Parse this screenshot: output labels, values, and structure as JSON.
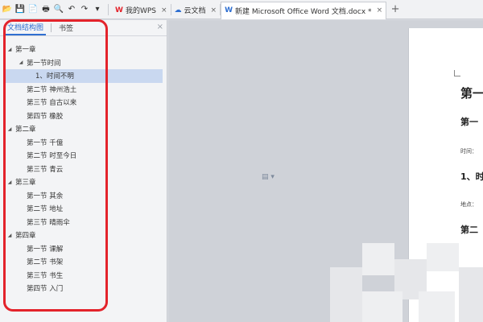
{
  "toolbar": {
    "quick_access": [
      {
        "icon": "folder-open-icon",
        "glyph": "📂"
      },
      {
        "icon": "save-icon",
        "glyph": "💾"
      },
      {
        "icon": "export-icon",
        "glyph": "📄"
      },
      {
        "icon": "print-icon",
        "glyph": "🖶"
      },
      {
        "icon": "print-preview-icon",
        "glyph": "🔍"
      },
      {
        "icon": "undo-icon",
        "glyph": "↶"
      },
      {
        "icon": "redo-icon",
        "glyph": "↷"
      },
      {
        "icon": "dropdown-icon",
        "glyph": "▾"
      }
    ],
    "tabs": [
      {
        "label": "我的WPS",
        "icon_glyph": "W",
        "icon_color": "#e3232b",
        "active": false
      },
      {
        "label": "云文档",
        "icon_glyph": "☁",
        "icon_color": "#2f6fd1",
        "active": false
      },
      {
        "label": "新建 Microsoft Office Word 文档.docx *",
        "icon_glyph": "W",
        "icon_color": "#2f6fd1",
        "active": true
      }
    ],
    "close_glyph": "×",
    "new_tab_glyph": "+"
  },
  "nav_panel": {
    "tabs": [
      "文档结构图",
      "书签"
    ],
    "close_glyph": "×",
    "outline": [
      {
        "label": "第一章",
        "level": 1,
        "expanded": true
      },
      {
        "label": "第一节时间",
        "level": 2,
        "expanded": true
      },
      {
        "label": "1、时间不明",
        "level": 3,
        "selected": true
      },
      {
        "label": "第二节 神州浩土",
        "level": "2-leaf"
      },
      {
        "label": "第三节 自古以来",
        "level": "2-leaf"
      },
      {
        "label": "第四节 橡胶",
        "level": "2-leaf"
      },
      {
        "label": "第二章",
        "level": 1,
        "expanded": true
      },
      {
        "label": "第一节 千億",
        "level": "2-leaf"
      },
      {
        "label": "第二节 时至今日",
        "level": "2-leaf"
      },
      {
        "label": "第三节 青云",
        "level": "2-leaf"
      },
      {
        "label": "第三章",
        "level": 1,
        "expanded": true
      },
      {
        "label": "第一节 其余",
        "level": "2-leaf"
      },
      {
        "label": "第二节 地址",
        "level": "2-leaf"
      },
      {
        "label": "第三节 晴雨伞",
        "level": "2-leaf"
      },
      {
        "label": "第四章",
        "level": 1,
        "expanded": true
      },
      {
        "label": "第一节 课解",
        "level": "2-leaf"
      },
      {
        "label": "第二节 书架",
        "level": "2-leaf"
      },
      {
        "label": "第三节 书生",
        "level": "2-leaf"
      },
      {
        "label": "第四节 入门",
        "level": "2-leaf"
      }
    ]
  },
  "document": {
    "lines": [
      {
        "text": "第一",
        "style": "h1"
      },
      {
        "text": "第一",
        "style": "h2"
      },
      {
        "text": "时间：",
        "style": "small"
      },
      {
        "text": "1、时",
        "style": "h2"
      },
      {
        "text": "地点：",
        "style": "small"
      },
      {
        "text": "第二",
        "style": "h2"
      }
    ]
  },
  "colors": {
    "highlight_border": "#e3232b",
    "active_tab_text": "#2f6fd1",
    "selected_row": "#c9d8f0"
  }
}
